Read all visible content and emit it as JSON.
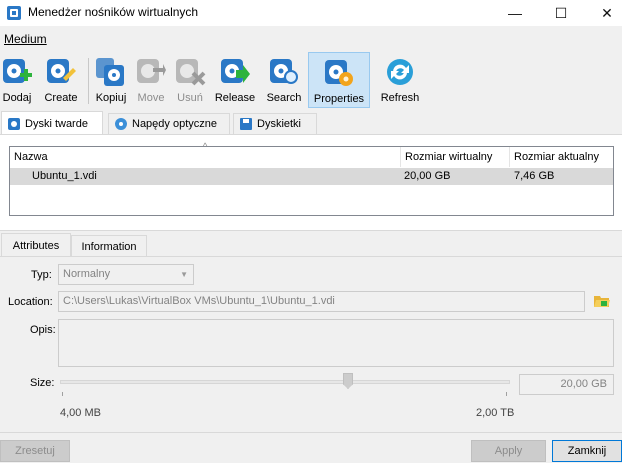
{
  "window": {
    "title": "Menedżer nośników wirtualnych",
    "controls": {
      "minimize": "—",
      "maximize": "☐",
      "close": "✕"
    }
  },
  "menu": {
    "medium": "Medium"
  },
  "toolbar": {
    "add": "Dodaj",
    "create": "Create",
    "copy": "Kopiuj",
    "move": "Move",
    "remove": "Usuń",
    "release": "Release",
    "search": "Search",
    "properties": "Properties",
    "refresh": "Refresh"
  },
  "media_tabs": {
    "hard_disks": "Dyski twarde",
    "optical": "Napędy optyczne",
    "floppy": "Dyskietki"
  },
  "table": {
    "headers": {
      "name": "Nazwa",
      "virtual_size": "Rozmiar wirtualny",
      "actual_size": "Rozmiar aktualny"
    },
    "rows": [
      {
        "name": "Ubuntu_1.vdi",
        "virtual_size": "20,00 GB",
        "actual_size": "7,46 GB"
      }
    ]
  },
  "detail_tabs": {
    "attributes": "Attributes",
    "information": "Information"
  },
  "attributes": {
    "type_label": "Typ:",
    "type_value": "Normalny",
    "location_label": "Location:",
    "location_value": "C:\\Users\\Lukas\\VirtualBox VMs\\Ubuntu_1\\Ubuntu_1.vdi",
    "description_label": "Opis:",
    "description_value": "",
    "size_label": "Size:",
    "size_value": "20,00 GB",
    "size_min": "4,00 MB",
    "size_max": "2,00 TB",
    "size_slider_fraction": 0.64
  },
  "buttons": {
    "reset": "Zresetuj",
    "apply": "Apply",
    "close": "Zamknij"
  },
  "colors": {
    "selection": "#cce4f7",
    "selected_row": "#d9d9d9",
    "icon_blue": "#2a78c6",
    "icon_green": "#2db33d",
    "icon_orange": "#f2a41c"
  }
}
